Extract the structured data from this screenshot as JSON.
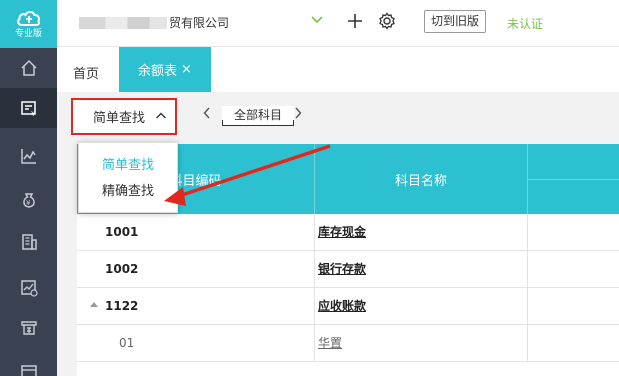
{
  "brand": {
    "label": "专业版",
    "icon": "cloud-icon"
  },
  "sidebar": {
    "items": [
      {
        "name": "home-icon",
        "active": false
      },
      {
        "name": "voucher-icon",
        "active": true
      },
      {
        "name": "chart-icon",
        "active": false
      },
      {
        "name": "money-bag-icon",
        "active": false
      },
      {
        "name": "building-icon",
        "active": false
      },
      {
        "name": "report-icon",
        "active": false
      },
      {
        "name": "cashier-icon",
        "active": false
      },
      {
        "name": "document-icon",
        "active": false
      }
    ]
  },
  "topbar": {
    "company_suffix": "贸有限公司",
    "switch_label": "切到旧版",
    "cert_label": "未认证"
  },
  "tabs": {
    "home": "首页",
    "active": "余额表",
    "close": "×"
  },
  "toolbar": {
    "search_mode": "简单查找",
    "all_subjects": "全部科目"
  },
  "dropdown": {
    "options": [
      "简单查找",
      "精确查找"
    ],
    "selected": "简单查找"
  },
  "table": {
    "headers": {
      "code": "科目编码",
      "name": "科目名称"
    },
    "rows": [
      {
        "code": "1001",
        "name": "库存现金",
        "level": 1
      },
      {
        "code": "1002",
        "name": "银行存款",
        "level": 1
      },
      {
        "code": "1122",
        "name": "应收账款",
        "level": 1,
        "expanded": true
      },
      {
        "code": "01",
        "name": "华置",
        "level": 2
      }
    ]
  },
  "colors": {
    "accent": "#2cc0d0",
    "sidebar": "#3a4252",
    "highlight": "#e0281e",
    "cert": "#7cc24a"
  }
}
